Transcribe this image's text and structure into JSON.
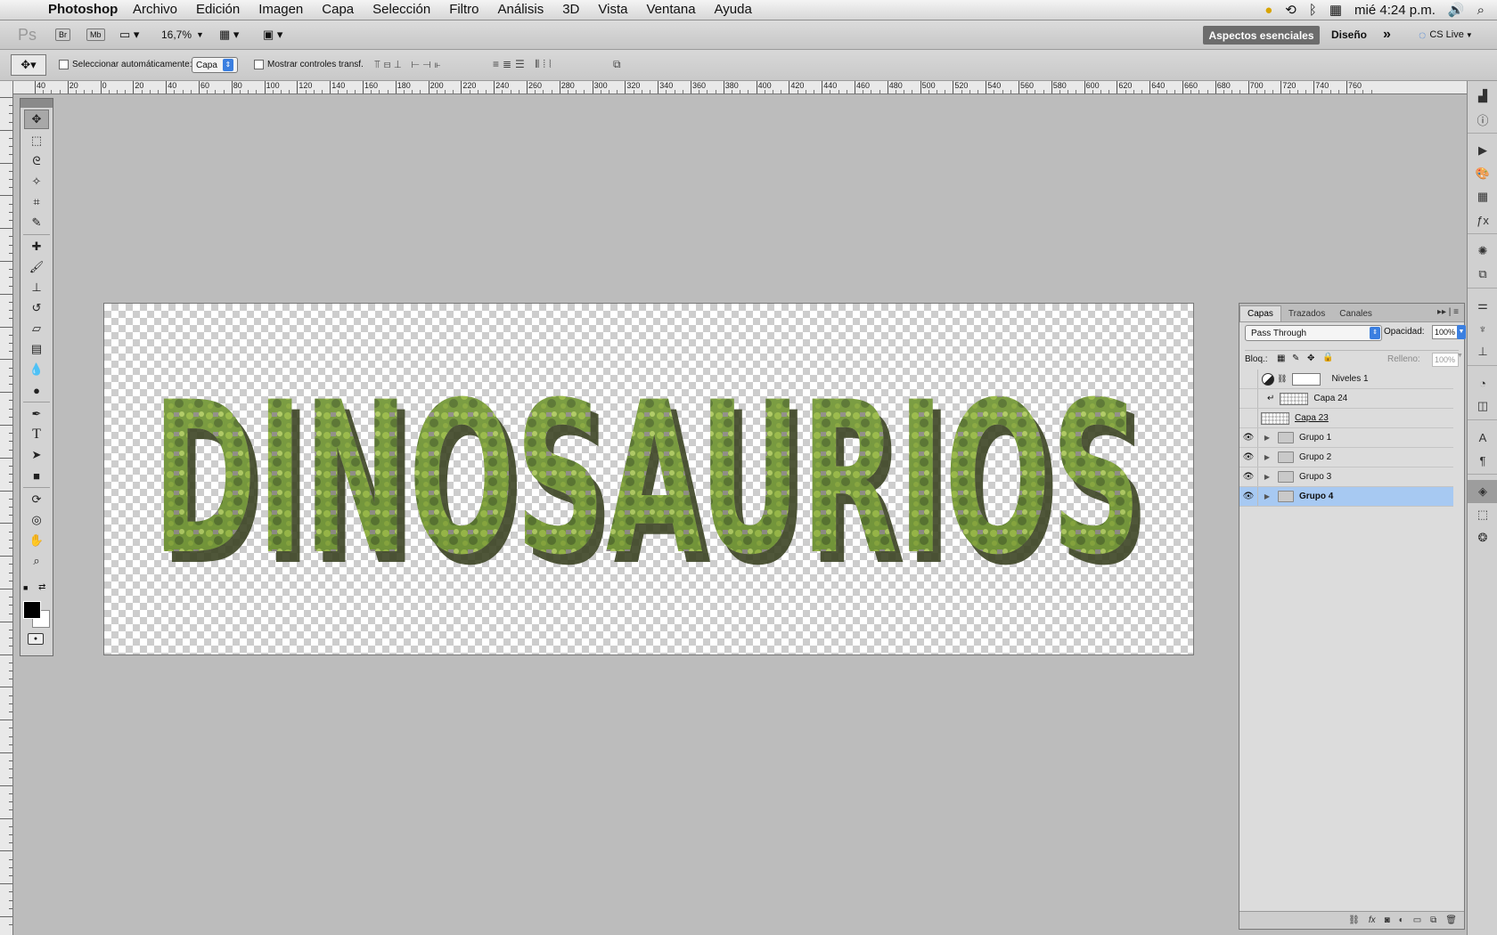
{
  "menubar": {
    "app_name": "Photoshop",
    "menus": [
      "Archivo",
      "Edición",
      "Imagen",
      "Capa",
      "Selección",
      "Filtro",
      "Análisis",
      "3D",
      "Vista",
      "Ventana",
      "Ayuda"
    ],
    "clock": "mié 4:24 p.m."
  },
  "appbar": {
    "ps_logo": "Ps",
    "br_label": "Br",
    "mb_label": "Mb",
    "zoom": "16,7%",
    "workspace_active": "Aspectos esenciales",
    "workspace_other": "Diseño",
    "more": "»",
    "cs_live": "CS Live"
  },
  "options": {
    "auto_select_label": "Seleccionar automáticamente:",
    "auto_select_target": "Capa",
    "show_transform_label": "Mostrar controles transf."
  },
  "ruler": {
    "top_ticks": [
      "40",
      "20",
      "0",
      "20",
      "40",
      "60",
      "80",
      "100",
      "120",
      "140",
      "160",
      "180",
      "200",
      "220",
      "240",
      "260",
      "280",
      "300",
      "320",
      "340",
      "360",
      "380",
      "400",
      "420",
      "440",
      "460",
      "480",
      "500",
      "520",
      "540",
      "560",
      "580",
      "600",
      "620",
      "640",
      "660",
      "680",
      "700",
      "720",
      "740",
      "760"
    ]
  },
  "canvas": {
    "artwork_text": "DINOSAURIOS",
    "colors": {
      "stone": "#8d8a83",
      "moss": "#6f9b2a",
      "shadow": "#3c4424"
    }
  },
  "layers_panel": {
    "tabs": [
      "Capas",
      "Trazados",
      "Canales"
    ],
    "blend_mode": "Pass Through",
    "opacity_label": "Opacidad:",
    "opacity_value": "100%",
    "lock_label": "Bloq.:",
    "fill_label": "Relleno:",
    "fill_value": "100%",
    "layers": [
      {
        "name": "Niveles 1",
        "kind": "adjustment",
        "visible": false,
        "selected": false
      },
      {
        "name": "Capa 24",
        "kind": "clipped",
        "visible": false,
        "selected": false
      },
      {
        "name": "Capa 23",
        "kind": "pixel",
        "visible": false,
        "selected": false
      },
      {
        "name": "Grupo 1",
        "kind": "group",
        "visible": true,
        "selected": false
      },
      {
        "name": "Grupo 2",
        "kind": "group",
        "visible": true,
        "selected": false
      },
      {
        "name": "Grupo 3",
        "kind": "group",
        "visible": true,
        "selected": false
      },
      {
        "name": "Grupo 4",
        "kind": "group",
        "visible": true,
        "selected": true
      }
    ],
    "selection_color": "#a7c9f2"
  }
}
